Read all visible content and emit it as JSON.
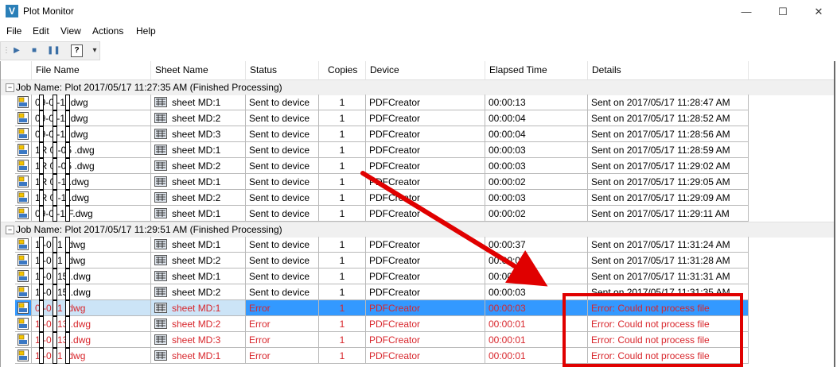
{
  "window": {
    "title": "Plot Monitor",
    "app_icon_letter": "V",
    "minimize": "—",
    "maximize": "☐",
    "close": "✕"
  },
  "menu": [
    "File",
    "Edit",
    "View",
    "Actions",
    "Help"
  ],
  "toolbar": {
    "icons": [
      "play-icon",
      "stop-icon",
      "pause-icon",
      "help-icon",
      "overflow-icon"
    ],
    "help_glyph": "?"
  },
  "columns": [
    "File Name",
    "Sheet Name",
    "Status",
    "Copies",
    "Device",
    "Elapsed Time",
    "Details"
  ],
  "groups": [
    {
      "label": "Job Name: Plot 2017/05/17 11:27:35 AM (Finished Processing)",
      "rows": [
        {
          "file": "09-0 -1 .dwg",
          "sheet": "sheet MD:1",
          "status": "Sent to device",
          "copies": "1",
          "device": "PDFCreator",
          "elapsed": "00:00:13",
          "details": "Sent on 2017/05/17 11:28:47 AM"
        },
        {
          "file": "09-0 -1 .dwg",
          "sheet": "sheet MD:2",
          "status": "Sent to device",
          "copies": "1",
          "device": "PDFCreator",
          "elapsed": "00:00:04",
          "details": "Sent on 2017/05/17 11:28:52 AM"
        },
        {
          "file": "09-0 -1 .dwg",
          "sheet": "sheet MD:3",
          "status": "Sent to device",
          "copies": "1",
          "device": "PDFCreator",
          "elapsed": "00:00:04",
          "details": "Sent on 2017/05/17 11:28:56 AM"
        },
        {
          "file": "1R 0 -05 .dwg",
          "sheet": "sheet MD:1",
          "status": "Sent to device",
          "copies": "1",
          "device": "PDFCreator",
          "elapsed": "00:00:03",
          "details": "Sent on 2017/05/17 11:28:59 AM"
        },
        {
          "file": "1R 0 -05 .dwg",
          "sheet": "sheet MD:2",
          "status": "Sent to device",
          "copies": "1",
          "device": "PDFCreator",
          "elapsed": "00:00:03",
          "details": "Sent on 2017/05/17 11:29:02 AM"
        },
        {
          "file": "1R 0 -1 .dwg",
          "sheet": "sheet MD:1",
          "status": "Sent to device",
          "copies": "1",
          "device": "PDFCreator",
          "elapsed": "00:00:02",
          "details": "Sent on 2017/05/17 11:29:05 AM"
        },
        {
          "file": "1R 0 -1 .dwg",
          "sheet": "sheet MD:2",
          "status": "Sent to device",
          "copies": "1",
          "device": "PDFCreator",
          "elapsed": "00:00:03",
          "details": "Sent on 2017/05/17 11:29:09 AM"
        },
        {
          "file": "09-0 -1 F.dwg",
          "sheet": "sheet MD:1",
          "status": "Sent to device",
          "copies": "1",
          "device": "PDFCreator",
          "elapsed": "00:00:02",
          "details": "Sent on 2017/05/17 11:29:11 AM"
        }
      ]
    },
    {
      "label": "Job Name: Plot 2017/05/17 11:29:51 AM (Finished Processing)",
      "rows": [
        {
          "file": "1 -0 -1 .dwg",
          "sheet": "sheet MD:1",
          "status": "Sent to device",
          "copies": "1",
          "device": "PDFCreator",
          "elapsed": "00:00:37",
          "details": "Sent on 2017/05/17 11:31:24 AM"
        },
        {
          "file": "1 -0 -1 .dwg",
          "sheet": "sheet MD:2",
          "status": "Sent to device",
          "copies": "1",
          "device": "PDFCreator",
          "elapsed": "00:00:03",
          "details": "Sent on 2017/05/17 11:31:28 AM"
        },
        {
          "file": "1 -0 -15 .dwg",
          "sheet": "sheet MD:1",
          "status": "Sent to device",
          "copies": "1",
          "device": "PDFCreator",
          "elapsed": "00:00:03",
          "details": "Sent on 2017/05/17 11:31:31 AM"
        },
        {
          "file": "1 -0 -15 .dwg",
          "sheet": "sheet MD:2",
          "status": "Sent to device",
          "copies": "1",
          "device": "PDFCreator",
          "elapsed": "00:00:03",
          "details": "Sent on 2017/05/17 11:31:35 AM"
        },
        {
          "file": "0 -0 -1 .dwg",
          "sheet": "sheet MD:1",
          "status": "Error",
          "copies": "1",
          "device": "PDFCreator",
          "elapsed": "00:00:03",
          "details": "Error: Could not process file",
          "error": true,
          "selected": true
        },
        {
          "file": "1 -0 -13 .dwg",
          "sheet": "sheet MD:2",
          "status": "Error",
          "copies": "1",
          "device": "PDFCreator",
          "elapsed": "00:00:01",
          "details": "Error: Could not process file",
          "error": true
        },
        {
          "file": "1 -0 -13 .dwg",
          "sheet": "sheet MD:3",
          "status": "Error",
          "copies": "1",
          "device": "PDFCreator",
          "elapsed": "00:00:01",
          "details": "Error: Could not process file",
          "error": true
        },
        {
          "file": "1 -0 -1 .dwg",
          "sheet": "sheet MD:1",
          "status": "Error",
          "copies": "1",
          "device": "PDFCreator",
          "elapsed": "00:00:01",
          "details": "Error: Could not process file",
          "error": true
        }
      ]
    }
  ],
  "colors": {
    "error_text": "#d8262c",
    "selection": "#3399ff",
    "annotation_red": "#e00000"
  }
}
